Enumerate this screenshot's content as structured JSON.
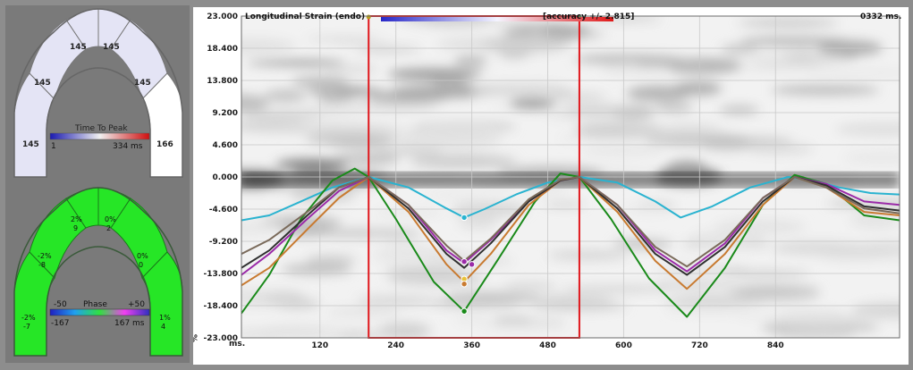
{
  "left_panel": {
    "top_map": {
      "segments": [
        "145",
        "145",
        "145",
        "145",
        "145",
        "166"
      ],
      "legend": {
        "title": "Time To Peak",
        "min": "1",
        "max": "334 ms"
      }
    },
    "bottom_map": {
      "segments": [
        {
          "top": "-2%",
          "bottom": "-7"
        },
        {
          "top": "-2%",
          "bottom": "-8"
        },
        {
          "top": "2%",
          "bottom": "9"
        },
        {
          "top": "0%",
          "bottom": "2"
        },
        {
          "top": "0%",
          "bottom": "0"
        },
        {
          "top": "1%",
          "bottom": "4"
        }
      ],
      "legend": {
        "title": "Phase",
        "min_top": "-50",
        "max_top": "+50",
        "min": "-167",
        "max": "167 ms"
      }
    }
  },
  "plot": {
    "title": "Longitudinal Strain (endo)",
    "accuracy": "[accuracy +/- 2.815]",
    "time_readout": "0332 ms.",
    "y_unit": "%",
    "x_unit": "ms.",
    "colors": {
      "selection": "#e0161b",
      "background": "#ffffff"
    }
  },
  "chart_data": {
    "type": "line",
    "y_ticks": [
      "23.000",
      "18.400",
      "13.800",
      "9.200",
      "4.600",
      "0.000",
      "-4.600",
      "-9.200",
      "-13.800",
      "-18.400",
      "-23.000"
    ],
    "x_ticks": [
      "120",
      "240",
      "360",
      "480",
      "600",
      "720",
      "840"
    ],
    "xlim": [
      -4,
      1036
    ],
    "ylim": [
      -23,
      23
    ],
    "selection_range_ms": [
      197,
      530
    ],
    "series": [
      {
        "color": "#2ab3d0",
        "x": [
          -4,
          40,
          90,
          140,
          197,
          260,
          320,
          348,
          380,
          430,
          480,
          530,
          590,
          650,
          690,
          740,
          800,
          860,
          900,
          940,
          990,
          1036
        ],
        "y": [
          -6.2,
          -5.5,
          -3.5,
          -1.5,
          0,
          -1.5,
          -4.5,
          -5.8,
          -4.6,
          -2.5,
          -0.8,
          0,
          -0.8,
          -3.5,
          -5.8,
          -4.2,
          -1.5,
          0,
          -0.5,
          -1.5,
          -2.3,
          -2.5
        ]
      },
      {
        "color": "#1a8a1a",
        "x": [
          -4,
          40,
          90,
          140,
          175,
          197,
          240,
          300,
          348,
          400,
          460,
          500,
          530,
          580,
          640,
          700,
          760,
          820,
          870,
          920,
          980,
          1036
        ],
        "y": [
          -19.5,
          -14,
          -6,
          -0.5,
          1.2,
          0,
          -6,
          -15,
          -19.2,
          -12,
          -3.5,
          0.5,
          0,
          -6,
          -14.5,
          -20,
          -13,
          -4,
          0.3,
          -1,
          -5.5,
          -6.2
        ]
      },
      {
        "color": "#c87a30",
        "x": [
          -4,
          40,
          100,
          150,
          197,
          260,
          320,
          348,
          390,
          450,
          500,
          530,
          590,
          650,
          700,
          760,
          820,
          870,
          920,
          980,
          1036
        ],
        "y": [
          -15.5,
          -13,
          -7.5,
          -3,
          0,
          -5,
          -12.5,
          -15,
          -11,
          -4,
          -0.5,
          0,
          -5,
          -12,
          -16,
          -11,
          -4,
          0,
          -1.5,
          -5,
          -5.5
        ]
      },
      {
        "color": "#9a2aa8",
        "x": [
          -4,
          40,
          100,
          150,
          197,
          260,
          320,
          348,
          390,
          450,
          500,
          530,
          590,
          650,
          700,
          760,
          820,
          870,
          920,
          980,
          1036
        ],
        "y": [
          -14,
          -11,
          -6,
          -2,
          0,
          -4,
          -10.5,
          -12.3,
          -9,
          -3.5,
          -0.5,
          0,
          -4,
          -10.5,
          -13.5,
          -9.5,
          -3,
          0,
          -1,
          -3.5,
          -4
        ]
      },
      {
        "color": "#303030",
        "x": [
          -4,
          40,
          100,
          150,
          197,
          260,
          320,
          348,
          390,
          450,
          500,
          530,
          590,
          650,
          700,
          760,
          820,
          870,
          920,
          980,
          1036
        ],
        "y": [
          -13,
          -10.5,
          -5.5,
          -1.5,
          0,
          -4.5,
          -11,
          -13,
          -9.5,
          -3.5,
          -0.5,
          0,
          -4.5,
          -11,
          -14,
          -10,
          -3.5,
          0,
          -1.2,
          -4.2,
          -4.8
        ]
      },
      {
        "color": "#7a6a5a",
        "x": [
          -4,
          40,
          100,
          150,
          197,
          260,
          320,
          348,
          390,
          450,
          500,
          530,
          590,
          650,
          700,
          760,
          820,
          870,
          920,
          980,
          1036
        ],
        "y": [
          -11,
          -9,
          -5,
          -1.5,
          0,
          -4,
          -9.8,
          -12,
          -8.8,
          -3.2,
          -0.4,
          0,
          -4,
          -10,
          -12.8,
          -9,
          -3,
          0,
          -1.5,
          -4.5,
          -5.2
        ]
      }
    ],
    "markers": [
      {
        "x": 348,
        "y": -5.8,
        "color": "#2ab3d0"
      },
      {
        "x": 348,
        "y": -12.1,
        "color": "#9a2aa8"
      },
      {
        "x": 348,
        "y": -14.6,
        "color": "#e8c23a"
      },
      {
        "x": 348,
        "y": -15.3,
        "color": "#c87a30"
      },
      {
        "x": 348,
        "y": -19.2,
        "color": "#1a8a1a"
      },
      {
        "x": 360,
        "y": -12.5,
        "color": "#9a2aa8"
      }
    ]
  }
}
